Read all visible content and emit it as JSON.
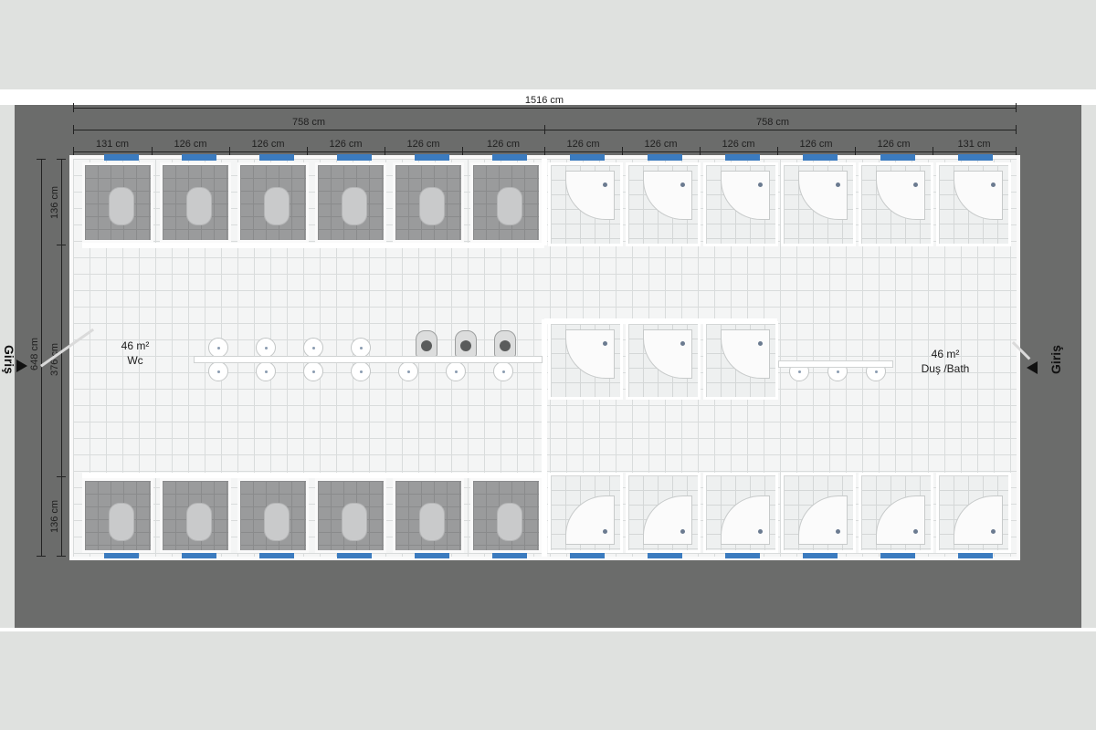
{
  "dimensions": {
    "total_width": "1516 cm",
    "halves": [
      "758 cm",
      "758 cm"
    ],
    "modules": [
      "131 cm",
      "126 cm",
      "126 cm",
      "126 cm",
      "126 cm",
      "126 cm",
      "126 cm",
      "126 cm",
      "126 cm",
      "126 cm",
      "126 cm",
      "131 cm"
    ],
    "total_depth": "648 cm",
    "depth_sections": [
      "136 cm",
      "376 cm",
      "136 cm"
    ]
  },
  "areas": {
    "wc": {
      "size": "46 m²",
      "name": "Wc"
    },
    "bath": {
      "size": "46 m²",
      "name": "Duş /Bath"
    }
  },
  "entrances": {
    "left": "Giriş",
    "right": "Giriş"
  },
  "colors": {
    "window": "#3b7bbf",
    "ground": "#6b6c6b",
    "background": "#dfe1df"
  }
}
